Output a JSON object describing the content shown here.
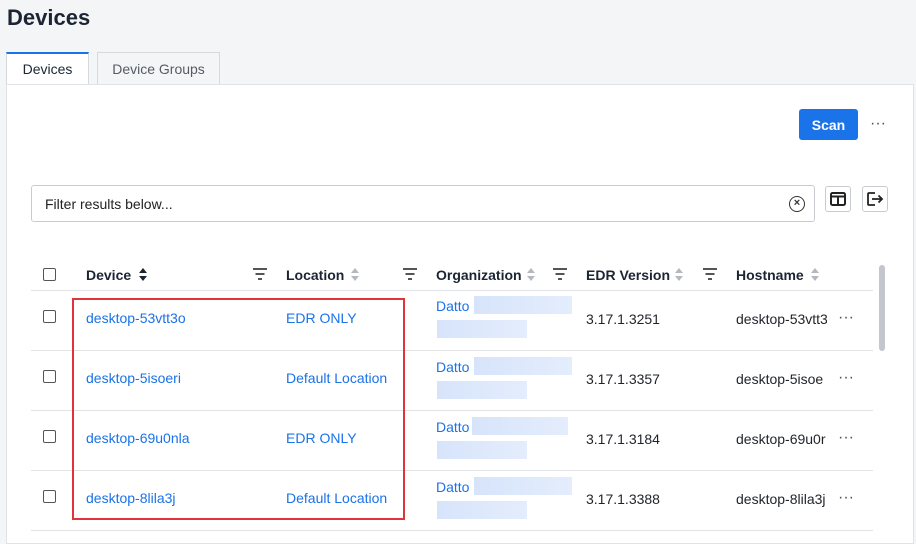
{
  "page": {
    "title": "Devices"
  },
  "tabs": [
    {
      "label": "Devices",
      "active": true
    },
    {
      "label": "Device Groups",
      "active": false
    }
  ],
  "toolbar": {
    "scan_label": "Scan",
    "more_icon": "ellipsis-icon"
  },
  "filter": {
    "placeholder": "Filter results below...",
    "value": ""
  },
  "icons": {
    "clear": "close-circle-icon",
    "columns": "columns-icon",
    "export": "export-icon"
  },
  "table": {
    "columns": {
      "device": "Device",
      "location": "Location",
      "organization": "Organization",
      "edr_version": "EDR Version",
      "hostname": "Hostname"
    },
    "rows": [
      {
        "device": "desktop-53vtt3o",
        "location": "EDR ONLY",
        "organization": "Datto",
        "edr_version": "3.17.1.3251",
        "hostname": "desktop-53vtt3"
      },
      {
        "device": "desktop-5isoeri",
        "location": "Default Location",
        "organization": "Datto",
        "edr_version": "3.17.1.3357",
        "hostname": "desktop-5isoe"
      },
      {
        "device": "desktop-69u0nla",
        "location": "EDR ONLY",
        "organization": "Datto",
        "edr_version": "3.17.1.3184",
        "hostname": "desktop-69u0r"
      },
      {
        "device": "desktop-8lila3j",
        "location": "Default Location",
        "organization": "Datto",
        "edr_version": "3.17.1.3388",
        "hostname": "desktop-8lila3j"
      }
    ]
  },
  "colors": {
    "accent": "#1a73e8",
    "highlight": "#e0343a"
  }
}
